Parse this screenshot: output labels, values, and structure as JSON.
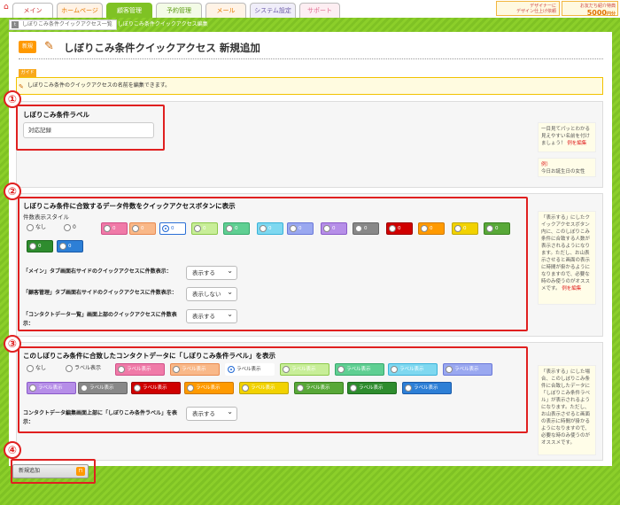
{
  "nav": {
    "tabs": [
      {
        "label": "メイン"
      },
      {
        "label": "ホームページ"
      },
      {
        "label": "顧客管理"
      },
      {
        "label": "予約管理"
      },
      {
        "label": "メール"
      },
      {
        "label": "システム設定"
      },
      {
        "label": "サポート"
      }
    ]
  },
  "ads": {
    "designer": "デザイナーに\nデザイン仕上げ依頼",
    "referral": "お友だち紹介特典",
    "amount": "5000",
    "unit": "円分"
  },
  "breadcrumb": {
    "parent": "しぼりこみ条件クイックアクセス一覧",
    "current": "> しぼりこみ条件クイックアクセス編集"
  },
  "page": {
    "badge": "新規",
    "title": "しぼりこみ条件クイックアクセス 新規追加"
  },
  "guide": {
    "label": "ガイド",
    "text": "しぼりこみ条件のクイックアクセスの名前を編集できます。"
  },
  "markers": [
    "①",
    "②",
    "③",
    "④"
  ],
  "sec1": {
    "label": "しぼりこみ条件ラベル",
    "value": "対応記録",
    "note_text": "一目見てパッとわかる見えやすい名前を付けましょう！",
    "note_example_label": "例を編集",
    "note_example2_label": "例）",
    "note_example2_text": "今日お誕生日の女性"
  },
  "sec2": {
    "title": "しぼりこみ条件に合致するデータ件数をクイックアクセスボタンに表示",
    "style_label": "件数表示スタイル",
    "none_label": "なし",
    "zero": "0",
    "rows": [
      {
        "label": "「メイン」タブ画面右サイドのクイックアクセスに件数表示：",
        "value": "表示する"
      },
      {
        "label": "「顧客管理」タブ画面右サイドのクイックアクセスに件数表示：",
        "value": "表示しない"
      },
      {
        "label": "「コンタクトデータ一覧」画面上部のクイックアクセスに件数表示：",
        "value": "表示する"
      }
    ],
    "note_text": "「表示する」にしたクイックアクセスボタン内に、このしぼりこみ条件に合致する人数が表示されるようになります。ただし、お山表示させると画面の表示に時間が掛かるようになりますので、必要な時のみ使うのがオススメです。",
    "note_link": "例を編集"
  },
  "sec3": {
    "title": "このしぼりこみ条件に合致したコンタクトデータに「しぼりこみ条件ラベル」を表示",
    "none_label": "なし",
    "plain_label": "ラベル表示",
    "opt_label": "ラベル表示",
    "row_label": "コンタクトデータ編集画面上部に「しぼりこみ条件ラベル」を表示：",
    "row_value": "表示する",
    "note_text": "「表示する」にした場合、このしぼりこみ条件に合致したデータに「しぼりこみ条件ラベル」が表示されるようになります。ただし、お山表示させると画面の表示に時間が掛かるようになりますので、必要な時のみ使うのがオススメです。"
  },
  "actions": {
    "add_label": "新規追加"
  },
  "colors": {
    "accent_green": "#7fc224",
    "marker_red": "#e02020",
    "selected_blue": "#2a6fd6"
  }
}
